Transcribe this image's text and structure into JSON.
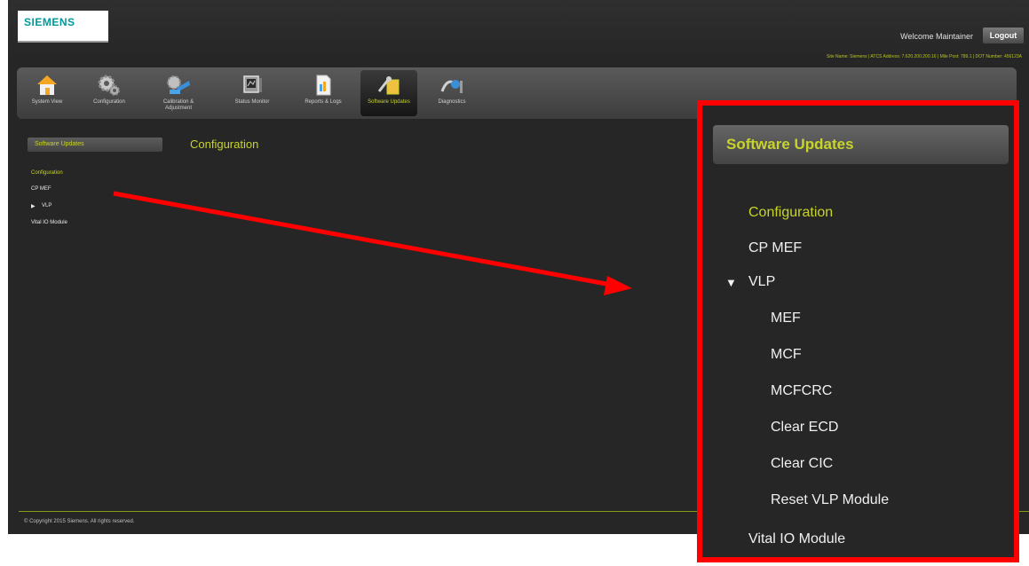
{
  "header": {
    "brand": "SIEMENS",
    "welcome": "Welcome Maintainer",
    "logout_label": "Logout",
    "site_info": "Site Name: Siemens | ATCS Address: 7.620.200.200.16 | Mile Post: 789.1 | DOT Number: 456123A"
  },
  "toolbar": [
    {
      "label": "System View",
      "icon": "house-icon"
    },
    {
      "label": "Configuration",
      "icon": "gears-icon"
    },
    {
      "label": "Calibration & Adjustment",
      "icon": "calibration-tools-icon"
    },
    {
      "label": "Status Monitor",
      "icon": "monitor-icon"
    },
    {
      "label": "Reports & Logs",
      "icon": "report-icon"
    },
    {
      "label": "Software Updates",
      "icon": "software-update-icon",
      "active": true
    },
    {
      "label": "Diagnostics",
      "icon": "diagnostics-icon"
    }
  ],
  "sidebar": {
    "title": "Software Updates",
    "items": [
      "Configuration",
      "CP MEF",
      "VLP",
      "Vital IO Module"
    ],
    "selected": "Configuration"
  },
  "content_title": "Configuration",
  "footer": "© Copyright 2015 Siemens. All rights reserved.",
  "zoom": {
    "title": "Software Updates",
    "items": [
      "Configuration",
      "CP MEF",
      "VLP",
      "Vital IO Module"
    ],
    "vlp_children": [
      "MEF",
      "MCF",
      "MCFCRC",
      "Clear ECD",
      "Clear CIC",
      "Reset VLP Module"
    ]
  },
  "colors": {
    "accent": "#c8d42a",
    "background": "#262626",
    "highlight_box": "#ff0000",
    "arrow": "#ff0000",
    "brand": "#009999"
  }
}
